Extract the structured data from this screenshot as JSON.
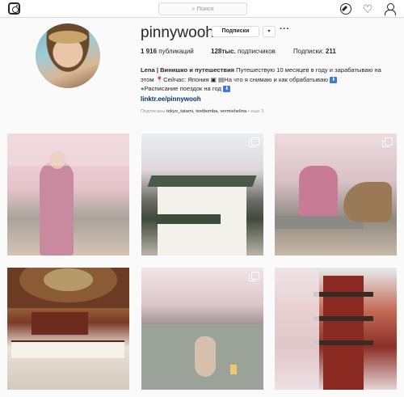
{
  "header": {
    "search_placeholder": "Поиск",
    "icons": [
      "instagram-logo-icon",
      "search-icon",
      "compass-icon",
      "heart-icon",
      "profile-icon"
    ]
  },
  "profile": {
    "username": "pinnywooh",
    "follow_label": "Подписки",
    "dropdown_glyph": "▾",
    "more_glyph": "···",
    "stats": {
      "posts": {
        "value": "1 916",
        "label": "публикаций"
      },
      "followers": {
        "value": "128тыс.",
        "label": "подписчиков"
      },
      "following": {
        "label": "Подписки:",
        "value": "211"
      }
    },
    "bio": {
      "name": "Lena | Винишко и путешествия",
      "line1_rest": "Путешествую 10 месяцев в году и зарабатываю на",
      "line2_start": "этом",
      "line2_location": "Сейчас: Япония",
      "line2_rest": "На что я снимаю и как обрабатываю",
      "line3": "Расписание поездок на год",
      "badge_glyph": "⬇"
    },
    "link": "linktr.ee/pinnywooh",
    "followed_by": {
      "prefix": "Подписаны",
      "names": "tokyo_tatami, textbomba, vermishelina",
      "more": "• еще 3"
    }
  },
  "posts": [
    {
      "name": "post-woman-pink-coat-cherry",
      "multi": false
    },
    {
      "name": "post-castle-sakura",
      "multi": true
    },
    {
      "name": "post-woman-feeding-deer",
      "multi": true
    },
    {
      "name": "post-temple-ceiling-shrine",
      "multi": false
    },
    {
      "name": "post-woman-river-lanterns",
      "multi": true
    },
    {
      "name": "post-pagoda-sakura",
      "multi": false
    }
  ]
}
